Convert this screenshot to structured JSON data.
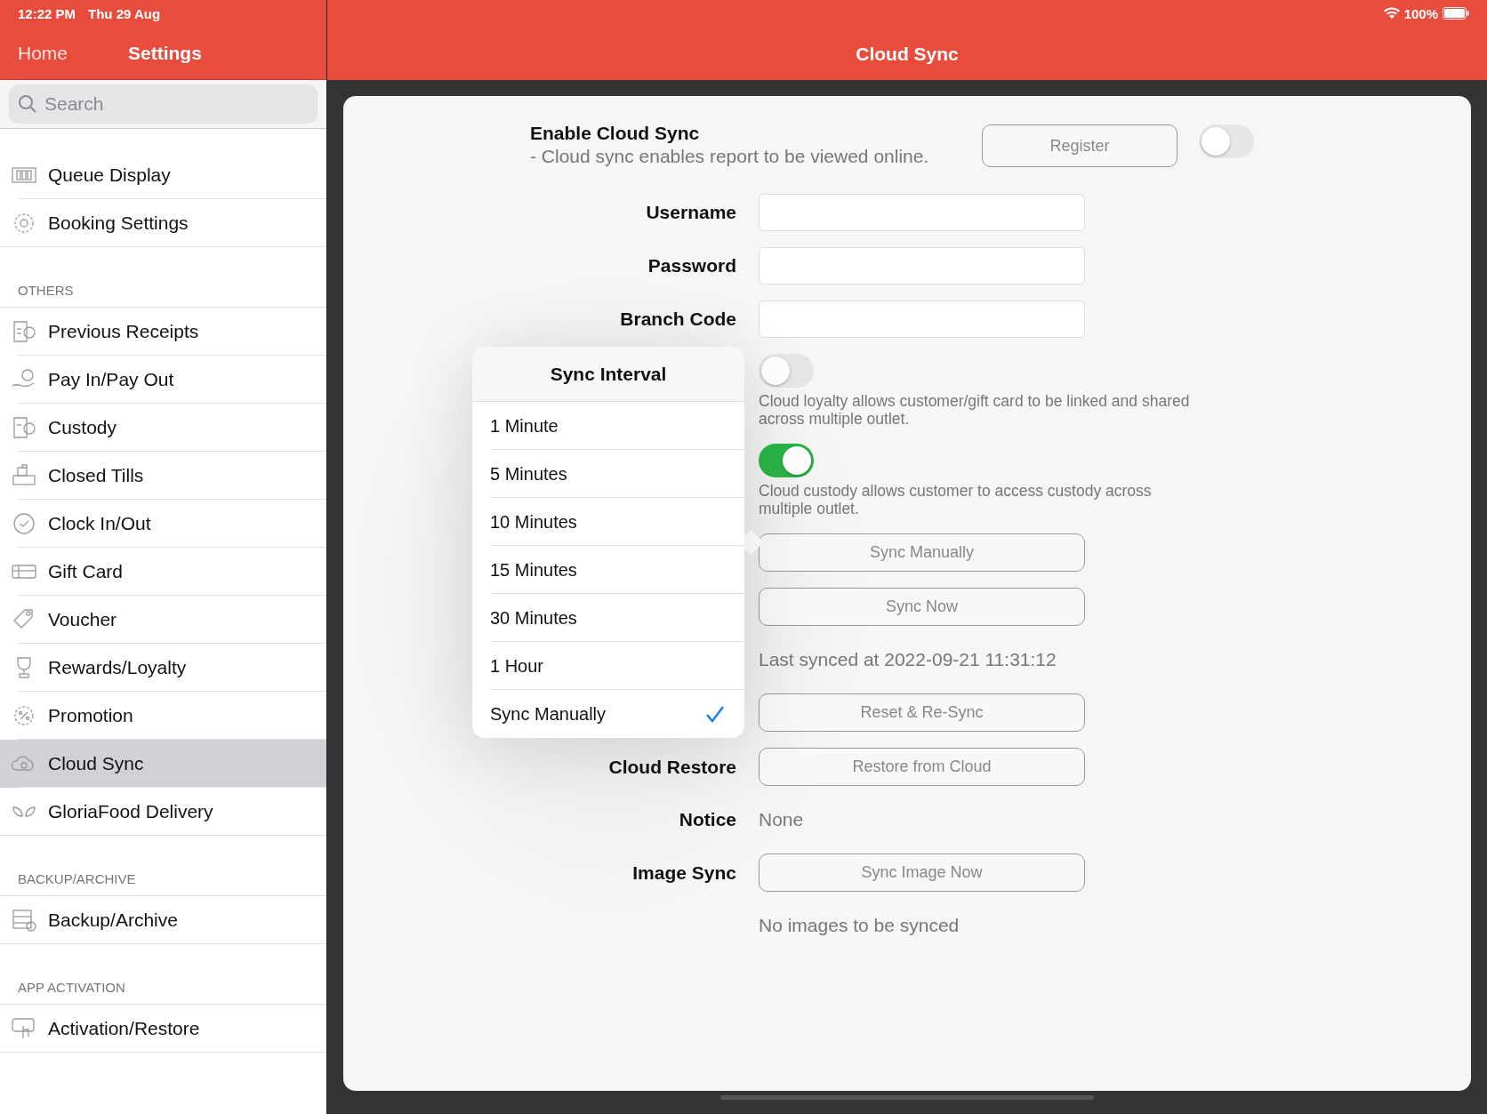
{
  "status_bar": {
    "time": "12:22 PM",
    "date": "Thu 29 Aug",
    "battery": "100%"
  },
  "sidebar": {
    "back": "Home",
    "title": "Settings",
    "search": {
      "placeholder": "Search"
    },
    "sections": [
      {
        "items": [
          {
            "label": "Queue Display",
            "selected": false
          },
          {
            "label": "Booking Settings",
            "selected": false
          }
        ]
      },
      {
        "header": "OTHERS",
        "items": [
          {
            "label": "Previous Receipts",
            "selected": false
          },
          {
            "label": "Pay In/Pay Out",
            "selected": false
          },
          {
            "label": "Custody",
            "selected": false
          },
          {
            "label": "Closed Tills",
            "selected": false
          },
          {
            "label": "Clock In/Out",
            "selected": false
          },
          {
            "label": "Gift Card",
            "selected": false
          },
          {
            "label": "Voucher",
            "selected": false
          },
          {
            "label": "Rewards/Loyalty",
            "selected": false
          },
          {
            "label": "Promotion",
            "selected": false
          },
          {
            "label": "Cloud Sync",
            "selected": true
          },
          {
            "label": "GloriaFood Delivery",
            "selected": false
          }
        ]
      },
      {
        "header": "BACKUP/ARCHIVE",
        "items": [
          {
            "label": "Backup/Archive",
            "selected": false
          }
        ]
      },
      {
        "header": "APP ACTIVATION",
        "items": [
          {
            "label": "Activation/Restore",
            "selected": false
          }
        ]
      }
    ]
  },
  "main": {
    "title": "Cloud Sync",
    "enable": {
      "title": "Enable Cloud Sync",
      "description": " - Cloud sync enables report to be viewed online.",
      "button": "Register",
      "on": false
    },
    "rows": [
      {
        "kind": "field",
        "label": "Username"
      },
      {
        "kind": "field",
        "label": "Password"
      },
      {
        "kind": "field",
        "label": "Branch Code"
      },
      {
        "kind": "toggle",
        "on": false,
        "description": "Cloud loyalty allows customer/gift card to be linked and shared across multiple outlet."
      },
      {
        "kind": "toggle",
        "on": true,
        "description": "Cloud custody allows customer to access custody across multiple outlet."
      },
      {
        "kind": "button",
        "text": "Sync Manually"
      },
      {
        "kind": "button",
        "text": "Sync Now"
      },
      {
        "kind": "text",
        "text": "Last synced at 2022-09-21 11:31:12"
      },
      {
        "kind": "button",
        "text": "Reset & Re-Sync"
      },
      {
        "kind": "button",
        "label": "Cloud Restore",
        "text": "Restore from Cloud"
      },
      {
        "kind": "text",
        "label": "Notice",
        "text": "None"
      },
      {
        "kind": "button",
        "label": "Image Sync",
        "text": "Sync Image Now"
      },
      {
        "kind": "text",
        "text": "No images to be synced"
      }
    ],
    "popover": {
      "title": "Sync Interval",
      "options": [
        {
          "label": "1 Minute",
          "selected": false
        },
        {
          "label": "5 Minutes",
          "selected": false
        },
        {
          "label": "10 Minutes",
          "selected": false
        },
        {
          "label": "15 Minutes",
          "selected": false
        },
        {
          "label": "30 Minutes",
          "selected": false
        },
        {
          "label": "1 Hour",
          "selected": false
        },
        {
          "label": "Sync Manually",
          "selected": true
        }
      ]
    }
  }
}
